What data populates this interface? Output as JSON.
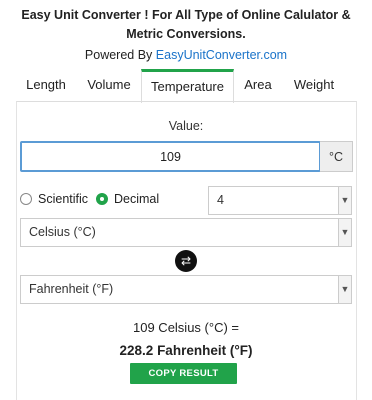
{
  "header": {
    "line1": "Easy Unit Converter ! For All Type of Online Calulator &",
    "line2": "Metric Conversions.",
    "powered_prefix": "Powered By ",
    "powered_link": "EasyUnitConverter.com"
  },
  "tabs": [
    {
      "label": "Length",
      "active": false
    },
    {
      "label": "Volume",
      "active": false
    },
    {
      "label": "Temperature",
      "active": true
    },
    {
      "label": "Area",
      "active": false
    },
    {
      "label": "Weight",
      "active": false
    }
  ],
  "value_section": {
    "label": "Value:",
    "input_value": "109",
    "unit": "°C"
  },
  "notation": {
    "scientific_label": "Scientific",
    "decimal_label": "Decimal",
    "selected": "Decimal",
    "precision_value": "4"
  },
  "from_unit": "Celsius (°C)",
  "to_unit": "Fahrenheit (°F)",
  "result": {
    "line1": "109 Celsius (°C) =",
    "line2": "228.2 Fahrenheit (°F)",
    "copy_label": "COPY RESULT"
  },
  "icons": {
    "swap": "swap-icon",
    "dropdown": "chevron-down-icon"
  },
  "colors": {
    "accent_green": "#21a34a",
    "link_blue": "#1a73c9",
    "input_border": "#5b9bd5"
  }
}
